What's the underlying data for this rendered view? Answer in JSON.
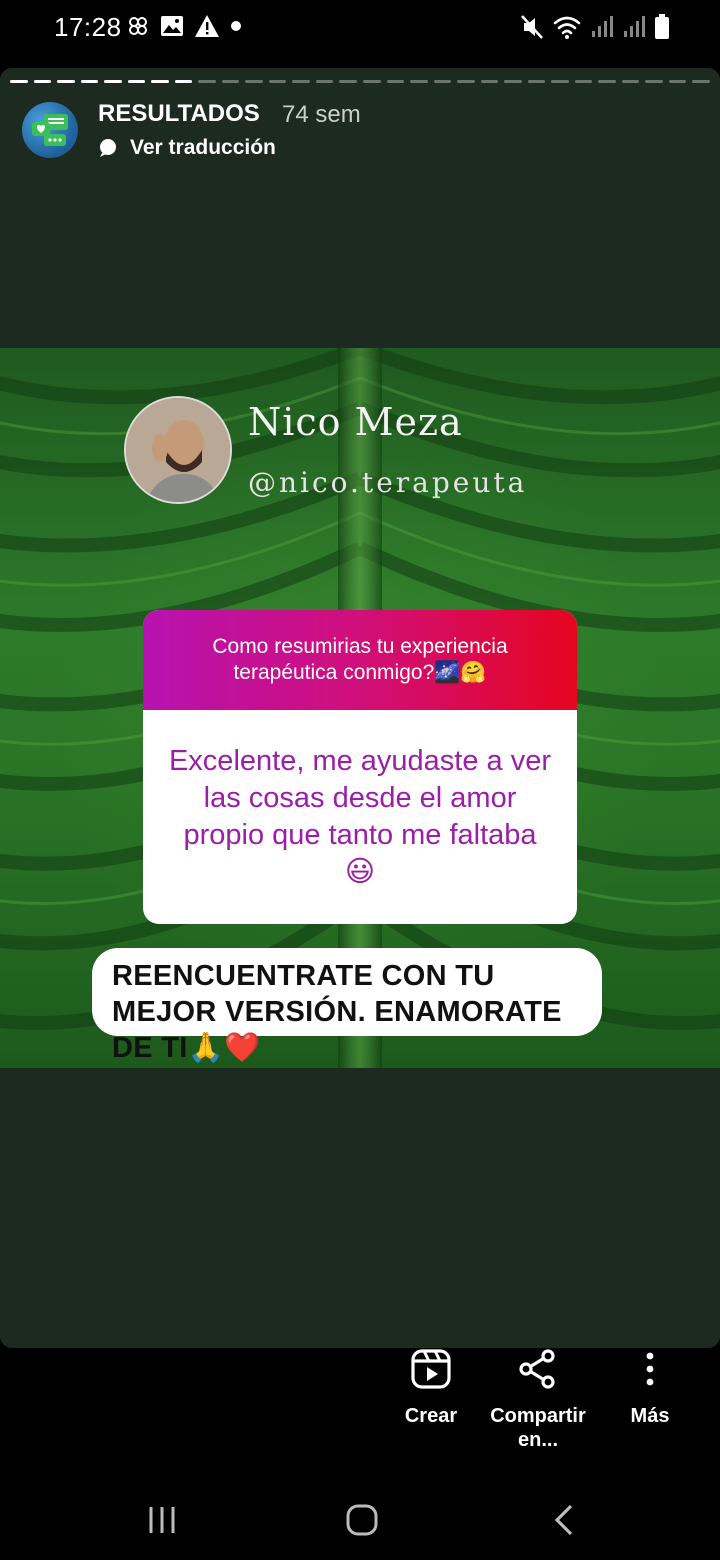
{
  "status_bar": {
    "time": "17:28",
    "left_icons": [
      "pinwheel-icon",
      "gallery-icon",
      "warning-icon",
      "dot-icon"
    ],
    "right_icons": [
      "mute-icon",
      "wifi-icon",
      "signal-icon",
      "signal-icon",
      "battery-icon"
    ]
  },
  "story": {
    "progress_segments": 30,
    "progress_done": 8,
    "account_name": "RESULTADOS",
    "time_ago": "74 sem",
    "translate_label": "Ver traducción"
  },
  "post": {
    "name": "Nico Meza",
    "handle": "@nico.terapeuta",
    "question": "Como resumirias tu experiencia terapéutica conmigo?🌌🤗",
    "answer": "Excelente, me ayudaste a ver las cosas desde el amor propio que tanto me faltaba 😃",
    "caption": "REENCUENTRATE CON TU MEJOR VERSIÓN. ENAMORATE DE TI🙏❤️",
    "colors": {
      "question_gradient_start": "#b712b0",
      "question_gradient_end": "#e5051f",
      "answer_text": "#9b1ea8"
    }
  },
  "actions": {
    "create_label": "Crear",
    "share_label": "Compartir en...",
    "more_label": "Más"
  },
  "navbar": {
    "icons": [
      "recent-apps-icon",
      "home-icon",
      "back-icon"
    ]
  }
}
